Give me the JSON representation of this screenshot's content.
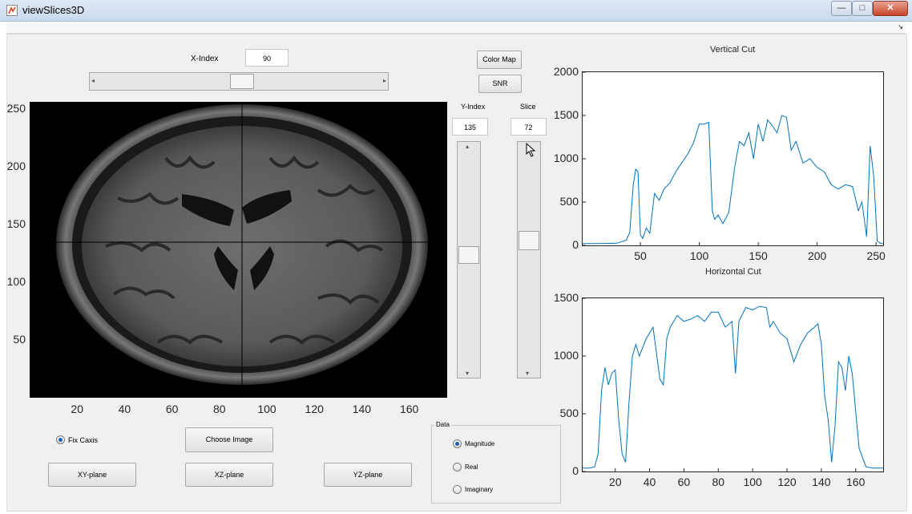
{
  "window": {
    "title": "viewSlices3D",
    "min_label": "—",
    "max_label": "□",
    "close_label": "✕"
  },
  "controls": {
    "x_index_label": "X-Index",
    "x_index_value": "90",
    "x_slider_fraction": 0.51,
    "y_index_label": "Y-Index",
    "y_index_value": "135",
    "y_slider_fraction": 0.47,
    "slice_label": "Slice",
    "slice_value": "72",
    "slice_slider_fraction": 0.4,
    "color_map_label": "Color Map",
    "snr_label": "SNR",
    "fix_caxis_label": "Fix Caxis",
    "choose_image_label": "Choose Image",
    "xy_plane_label": "XY-plane",
    "xz_plane_label": "XZ-plane",
    "yz_plane_label": "YZ-plane"
  },
  "data_panel": {
    "title": "Data",
    "options": [
      "Magnitude",
      "Real",
      "Imaginary"
    ],
    "selected": "Magnitude"
  },
  "image_axes": {
    "x_ticks": [
      "20",
      "40",
      "60",
      "80",
      "100",
      "120",
      "140",
      "160"
    ],
    "y_ticks": [
      "250",
      "200",
      "150",
      "100",
      "50"
    ],
    "crosshair_x": 90,
    "crosshair_y": 135,
    "image_type": "axial brain MRI slice (grayscale)"
  },
  "chart_data": [
    {
      "type": "line",
      "title": "Vertical Cut",
      "xlim": [
        1,
        256
      ],
      "ylim": [
        0,
        2000
      ],
      "x_ticks": [
        "50",
        "100",
        "150",
        "200",
        "250"
      ],
      "y_ticks": [
        "2000",
        "1500",
        "1000",
        "500",
        "0"
      ],
      "color": "#0072bd",
      "x": [
        1,
        10,
        20,
        30,
        38,
        41,
        44,
        46,
        48,
        50,
        52,
        55,
        58,
        62,
        66,
        70,
        75,
        80,
        85,
        90,
        95,
        100,
        104,
        108,
        111,
        113,
        116,
        120,
        125,
        130,
        134,
        138,
        142,
        146,
        150,
        154,
        158,
        162,
        166,
        170,
        174,
        178,
        182,
        188,
        194,
        200,
        206,
        212,
        218,
        224,
        230,
        235,
        238,
        242,
        245,
        248,
        251,
        254,
        256
      ],
      "y": [
        20,
        20,
        22,
        25,
        60,
        150,
        700,
        880,
        850,
        120,
        80,
        200,
        140,
        600,
        520,
        650,
        720,
        850,
        950,
        1050,
        1180,
        1400,
        1400,
        1420,
        400,
        300,
        350,
        250,
        380,
        900,
        1200,
        1150,
        1300,
        1000,
        1400,
        1200,
        1450,
        1380,
        1300,
        1500,
        1480,
        1100,
        1200,
        950,
        1000,
        900,
        850,
        700,
        650,
        700,
        680,
        400,
        500,
        100,
        1150,
        800,
        50,
        20,
        20
      ]
    },
    {
      "type": "line",
      "title": "Horizontal Cut",
      "xlim": [
        1,
        176
      ],
      "ylim": [
        0,
        1500
      ],
      "x_ticks": [
        "20",
        "40",
        "60",
        "80",
        "100",
        "120",
        "140",
        "160"
      ],
      "y_ticks": [
        "1500",
        "1000",
        "500",
        "0"
      ],
      "color": "#0072bd",
      "x": [
        1,
        5,
        8,
        10,
        12,
        14,
        16,
        18,
        20,
        22,
        24,
        26,
        28,
        30,
        32,
        34,
        38,
        42,
        46,
        48,
        50,
        52,
        56,
        60,
        64,
        68,
        72,
        76,
        80,
        84,
        88,
        90,
        92,
        96,
        100,
        104,
        108,
        110,
        112,
        116,
        120,
        124,
        128,
        132,
        136,
        138,
        140,
        142,
        144,
        146,
        148,
        150,
        152,
        154,
        156,
        158,
        162,
        166,
        170,
        176
      ],
      "y": [
        30,
        30,
        40,
        150,
        700,
        900,
        750,
        850,
        880,
        450,
        150,
        80,
        600,
        1000,
        1100,
        1000,
        1150,
        1250,
        800,
        750,
        1150,
        1250,
        1350,
        1300,
        1320,
        1350,
        1300,
        1380,
        1380,
        1250,
        1300,
        850,
        1300,
        1420,
        1400,
        1430,
        1420,
        1250,
        1300,
        1200,
        1150,
        950,
        1100,
        1200,
        1250,
        1280,
        1100,
        650,
        450,
        80,
        400,
        950,
        900,
        700,
        1000,
        850,
        200,
        40,
        30,
        30
      ]
    }
  ]
}
